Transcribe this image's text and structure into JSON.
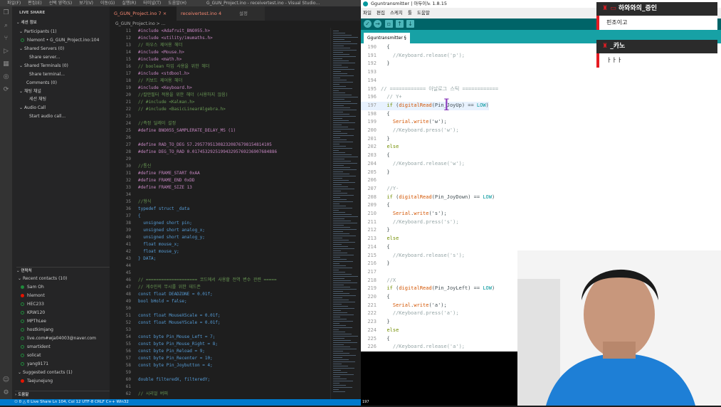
{
  "vscode": {
    "title": "G_GUN_Project.ino - receivertest.ino - Visual Studio...",
    "menus": [
      "파일(F)",
      "편집(E)",
      "선택 영역(S)",
      "보기(V)",
      "이동(G)",
      "실행(R)",
      "터미널(T)",
      "도움말(H)"
    ],
    "sidebar": {
      "header": "LIVE SHARE",
      "session_title": "세션 정보",
      "participants": "Participants (1)",
      "participant_name": "hlemont • G_GUN_Project.ino:104",
      "shared_servers": "Shared Servers (0)",
      "share_server": "Share server...",
      "shared_terminals": "Shared Terminals (0)",
      "share_terminal": "Share terminal...",
      "comments": "Comments (0)",
      "chat_channel": "채팅 채널",
      "session_chat": "세션 채팅",
      "audio_call": "Audio Call",
      "start_audio": "Start audio call...",
      "contacts_title": "연락처",
      "recent": "Recent contacts (10)",
      "contacts": [
        {
          "name": "Sam Oh",
          "status": "green"
        },
        {
          "name": "hlemont",
          "status": "red"
        },
        {
          "name": "HEC233",
          "status": "ring"
        },
        {
          "name": "KRW120",
          "status": "ring"
        },
        {
          "name": "MPThLee",
          "status": "ring"
        },
        {
          "name": "hostkimjang",
          "status": "ring"
        },
        {
          "name": "live.com#wja04003@naver.com",
          "status": "ring"
        },
        {
          "name": "smartident",
          "status": "ring"
        },
        {
          "name": "solicat",
          "status": "ring"
        },
        {
          "name": "yang9171",
          "status": "ring"
        }
      ],
      "suggested": "Suggested contacts (1)",
      "suggested_contact": "Taejunejung",
      "outline": "도움말"
    },
    "tabs": [
      {
        "label": "G_GUN_Project.ino 7",
        "active": true
      },
      {
        "label": "receivertest.ino 4",
        "active": false
      },
      {
        "label": "설정",
        "active": false
      }
    ],
    "breadcrumb": "G_GUN_Project.ino > ...",
    "code_lines": [
      {
        "n": "11",
        "t": "#include <Adafruit_BNO055.h>"
      },
      {
        "n": "12",
        "t": "#include <utility/imumaths.h>"
      },
      {
        "n": "13",
        "t": "// 마우스 제어용 헤더"
      },
      {
        "n": "14",
        "t": "#include <Mouse.h>"
      },
      {
        "n": "15",
        "t": "#include <math.h>"
      },
      {
        "n": "16",
        "t": "// boolean 타입 사용을 위한 헤더"
      },
      {
        "n": "17",
        "t": "#include <stdbool.h>"
      },
      {
        "n": "18",
        "t": "// 키보드 제어용 헤더"
      },
      {
        "n": "19",
        "t": "#include <Keyboard.h>"
      },
      {
        "n": "20",
        "t": "//칼만필터 적용을 위한 헤더 (사용하지 않음)"
      },
      {
        "n": "21",
        "t": "// #include <Kalman.h>"
      },
      {
        "n": "22",
        "t": "// #include <BasicLinearAlgebra.h>"
      },
      {
        "n": "23",
        "t": ""
      },
      {
        "n": "24",
        "t": "//측정 딜레이 설정"
      },
      {
        "n": "25",
        "t": "#define BNO055_SAMPLERATE_DELAY_MS (1)"
      },
      {
        "n": "26",
        "t": ""
      },
      {
        "n": "27",
        "t": "#define RAD_TO_DEG 57.295779513082320876798154814105"
      },
      {
        "n": "28",
        "t": "#define DEG_TO_RAD 0.017453292519943295769236907684886"
      },
      {
        "n": "29",
        "t": ""
      },
      {
        "n": "30",
        "t": "//통신"
      },
      {
        "n": "31",
        "t": "#define FRAME_START 0xAA"
      },
      {
        "n": "32",
        "t": "#define FRAME_END 0xDD"
      },
      {
        "n": "33",
        "t": "#define FRAME_SIZE 13"
      },
      {
        "n": "34",
        "t": ""
      },
      {
        "n": "35",
        "t": "//형식"
      },
      {
        "n": "36",
        "t": "typedef struct _data"
      },
      {
        "n": "37",
        "t": "{"
      },
      {
        "n": "38",
        "t": "  unsigned short pin;"
      },
      {
        "n": "39",
        "t": "  unsigned short analog_x;"
      },
      {
        "n": "40",
        "t": "  unsigned short analog_y;"
      },
      {
        "n": "41",
        "t": "  float mouse_x;"
      },
      {
        "n": "42",
        "t": "  float mouse_y;"
      },
      {
        "n": "43",
        "t": "} DATA;"
      },
      {
        "n": "44",
        "t": ""
      },
      {
        "n": "45",
        "t": ""
      },
      {
        "n": "46",
        "t": "// ==================== 코드에서 사용할 전역 변수 관련 ====="
      },
      {
        "n": "47",
        "t": "// 게수민의 무시를 위한 데드존"
      },
      {
        "n": "48",
        "t": "const float DEADZONE = 0.01f;"
      },
      {
        "n": "49",
        "t": "bool bHold = false;"
      },
      {
        "n": "50",
        "t": ""
      },
      {
        "n": "51",
        "t": "const float MouseXScale = 0.01f;"
      },
      {
        "n": "52",
        "t": "const float MouseYScale = 0.01f;"
      },
      {
        "n": "53",
        "t": ""
      },
      {
        "n": "54",
        "t": "const byte Pin_Mouse_Left = 7;"
      },
      {
        "n": "55",
        "t": "const byte Pin_Mouse_Right = 8;"
      },
      {
        "n": "56",
        "t": "const byte Pin_Reload = 9;"
      },
      {
        "n": "57",
        "t": "const byte Pin_Recenter = 10;"
      },
      {
        "n": "58",
        "t": "const byte Pin_Joybutton = 4;"
      },
      {
        "n": "59",
        "t": ""
      },
      {
        "n": "60",
        "t": "double filteredX, filteredY;"
      },
      {
        "n": "61",
        "t": ""
      },
      {
        "n": "62",
        "t": "// 시리얼 버퍼"
      }
    ],
    "status": "⚇ 0 △ 0  Live Share  Ln 104, Col 12  UTF-8  CRLF  C++  Win32"
  },
  "arduino": {
    "title": "Gguntransmitter | 아두이노 1.8.15",
    "menus": [
      "파일",
      "편집",
      "스케치",
      "툴",
      "도움말"
    ],
    "tab": "Gguntransmitter §",
    "lines": [
      {
        "n": "190",
        "t": "  {"
      },
      {
        "n": "191",
        "t": "    //Keyboard.release('p');"
      },
      {
        "n": "192",
        "t": "  }"
      },
      {
        "n": "193",
        "t": ""
      },
      {
        "n": "194",
        "t": ""
      },
      {
        "n": "195",
        "t": "// ============ 아날로그 스틱 ============"
      },
      {
        "n": "196",
        "t": "  // Y+"
      },
      {
        "n": "197",
        "t": "  if (digitalRead(Pin_JoyUp) == LOW)"
      },
      {
        "n": "198",
        "t": "  {"
      },
      {
        "n": "199",
        "t": "    Serial.write('w');"
      },
      {
        "n": "200",
        "t": "    //Keyboard.press('w');"
      },
      {
        "n": "201",
        "t": "  }"
      },
      {
        "n": "202",
        "t": "  else"
      },
      {
        "n": "203",
        "t": "  {"
      },
      {
        "n": "204",
        "t": "    //Keyboard.release('w');"
      },
      {
        "n": "205",
        "t": "  }"
      },
      {
        "n": "206",
        "t": ""
      },
      {
        "n": "207",
        "t": "  //Y-"
      },
      {
        "n": "208",
        "t": "  if (digitalRead(Pin_JoyDown) == LOW)"
      },
      {
        "n": "209",
        "t": "  {"
      },
      {
        "n": "210",
        "t": "    Serial.write('s');"
      },
      {
        "n": "211",
        "t": "    //Keyboard.press('s');"
      },
      {
        "n": "212",
        "t": "  }"
      },
      {
        "n": "213",
        "t": "  else"
      },
      {
        "n": "214",
        "t": "  {"
      },
      {
        "n": "215",
        "t": "    //Keyboard.release('s');"
      },
      {
        "n": "216",
        "t": "  }"
      },
      {
        "n": "217",
        "t": ""
      },
      {
        "n": "218",
        "t": "  //X"
      },
      {
        "n": "219",
        "t": "  if (digitalRead(Pin_JoyLeft) == LOW)"
      },
      {
        "n": "220",
        "t": "  {"
      },
      {
        "n": "221",
        "t": "    Serial.write('a');"
      },
      {
        "n": "222",
        "t": "    //Keyboard.press('a');"
      },
      {
        "n": "223",
        "t": "  }"
      },
      {
        "n": "224",
        "t": "  else"
      },
      {
        "n": "225",
        "t": "  {"
      },
      {
        "n": "226",
        "t": "    //Keyboard.release('a');"
      }
    ],
    "status_line": "197"
  },
  "chat": [
    {
      "name": "하와와의_증인",
      "message": "핀조이고"
    },
    {
      "name": "_카노",
      "message": "ㅏㅏㅏ"
    }
  ],
  "colors": {
    "vscode_status": "#007acc",
    "arduino_teal": "#006468",
    "arduino_tab": "#17a1a5",
    "chat_accent": "#e51c23"
  }
}
